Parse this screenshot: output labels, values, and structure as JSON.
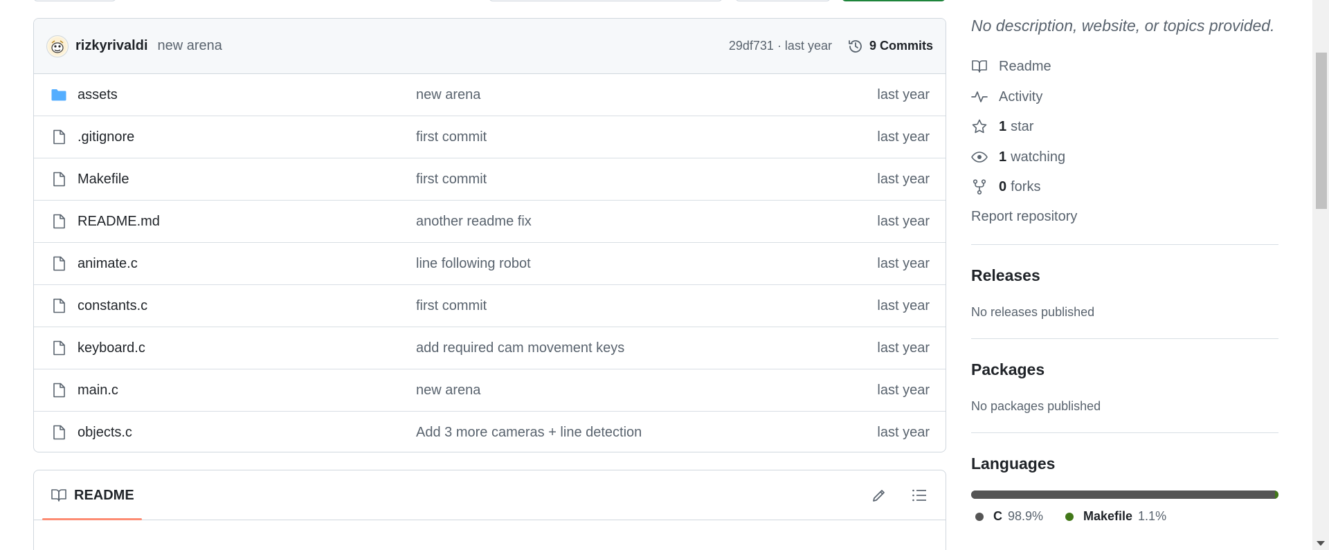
{
  "commit_bar": {
    "user": "rizkyrivaldi",
    "message": "new arena",
    "hash_time": "29df731 · last year",
    "commits_label": "9 Commits"
  },
  "files": [
    {
      "name": "assets",
      "type": "folder",
      "message": "new arena",
      "time": "last year"
    },
    {
      "name": ".gitignore",
      "type": "file",
      "message": "first commit",
      "time": "last year"
    },
    {
      "name": "Makefile",
      "type": "file",
      "message": "first commit",
      "time": "last year"
    },
    {
      "name": "README.md",
      "type": "file",
      "message": "another readme fix",
      "time": "last year"
    },
    {
      "name": "animate.c",
      "type": "file",
      "message": "line following robot",
      "time": "last year"
    },
    {
      "name": "constants.c",
      "type": "file",
      "message": "first commit",
      "time": "last year"
    },
    {
      "name": "keyboard.c",
      "type": "file",
      "message": "add required cam movement keys",
      "time": "last year"
    },
    {
      "name": "main.c",
      "type": "file",
      "message": "new arena",
      "time": "last year"
    },
    {
      "name": "objects.c",
      "type": "file",
      "message": "Add 3 more cameras + line detection",
      "time": "last year"
    }
  ],
  "readme": {
    "tab_label": "README"
  },
  "sidebar": {
    "description": "No description, website, or topics provided.",
    "readme": "Readme",
    "activity": "Activity",
    "stars_count": "1",
    "stars_label": "star",
    "watching_count": "1",
    "watching_label": "watching",
    "forks_count": "0",
    "forks_label": "forks",
    "report": "Report repository",
    "releases_title": "Releases",
    "releases_sub": "No releases published",
    "packages_title": "Packages",
    "packages_sub": "No packages published",
    "languages_title": "Languages",
    "languages": [
      {
        "name": "C",
        "percent": "98.9%",
        "value": 98.9,
        "color": "#555555"
      },
      {
        "name": "Makefile",
        "percent": "1.1%",
        "value": 1.1,
        "color": "#427819"
      }
    ]
  },
  "colors": {
    "accent_green": "#1f883d",
    "folder_blue": "#54aeff",
    "tab_underline": "#fd8c73"
  }
}
